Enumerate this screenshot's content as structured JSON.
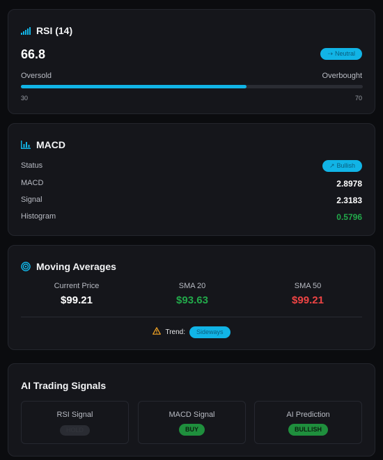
{
  "rsi": {
    "title": "RSI (14)",
    "value": "66.8",
    "status_badge": "Neutral",
    "oversold_label": "Oversold",
    "overbought_label": "Overbought",
    "low_tick": "30",
    "high_tick": "70",
    "gauge_fraction": 0.66,
    "accent_color": "#11b4e6"
  },
  "macd": {
    "title": "MACD",
    "status_label": "Status",
    "status_badge": "Bullish",
    "rows": [
      {
        "label": "MACD",
        "value": "2.8978"
      },
      {
        "label": "Signal",
        "value": "2.3183"
      },
      {
        "label": "Histogram",
        "value": "0.5796"
      }
    ]
  },
  "moving_averages": {
    "title": "Moving Averages",
    "columns": [
      {
        "label": "Current Price",
        "value": "$99.21",
        "color": "#ffffff"
      },
      {
        "label": "SMA 20",
        "value": "$93.63",
        "color": "#22a94a"
      },
      {
        "label": "SMA 50",
        "value": "$99.21",
        "color": "#ef4444"
      }
    ],
    "trend_label": "Trend:",
    "trend_badge": "Sideways"
  },
  "ai_signals": {
    "title": "AI Trading Signals",
    "cards": [
      {
        "label": "RSI Signal",
        "badge": "HOLD"
      },
      {
        "label": "MACD Signal",
        "badge": "BUY"
      },
      {
        "label": "AI Prediction",
        "badge": "BULLISH"
      }
    ]
  },
  "colors": {
    "background": "#0b0c0f",
    "card": "#15161b",
    "accent": "#11b4e6",
    "positive": "#22a94a",
    "negative": "#ef4444",
    "warning": "#f5a524"
  },
  "icons": {
    "rsi": "signal-bars-icon",
    "macd": "bar-chart-icon",
    "moving_averages": "target-icon",
    "trend": "warning-triangle-icon"
  }
}
